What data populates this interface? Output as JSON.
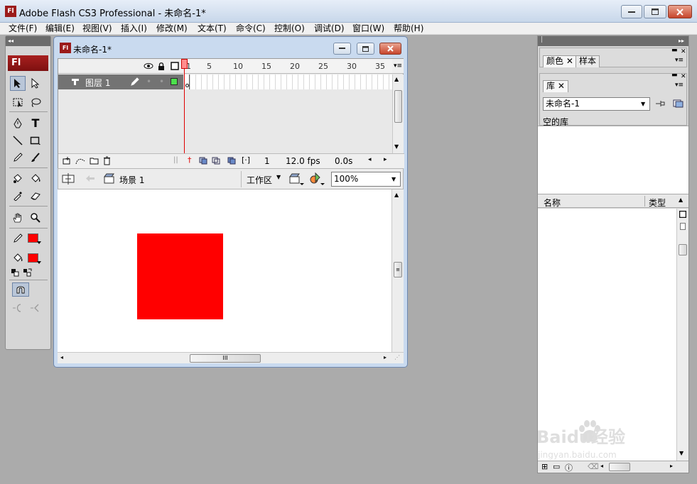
{
  "app": {
    "title": "Adobe Flash CS3 Professional - 未命名-1*",
    "logo": "Fl"
  },
  "menu": [
    "文件(F)",
    "编辑(E)",
    "视图(V)",
    "插入(I)",
    "修改(M)",
    "文本(T)",
    "命令(C)",
    "控制(O)",
    "调试(D)",
    "窗口(W)",
    "帮助(H)"
  ],
  "toolbox": {
    "badge": "Fl",
    "text_tool": "T",
    "stroke_color": "#ff0000",
    "fill_color": "#ff0000"
  },
  "document": {
    "title": "未命名-1*",
    "timeline": {
      "frame_numbers": [
        "1",
        "5",
        "10",
        "15",
        "20",
        "25",
        "30",
        "35"
      ],
      "layer_name": "图层 1",
      "current_frame": "1",
      "fps": "12.0 fps",
      "time": "0.0s"
    },
    "editbar": {
      "scene": "场景 1",
      "workspace": "工作区",
      "zoom": "100%"
    },
    "stage": {
      "shape_color": "#ff0000"
    },
    "scroll_grip": "III"
  },
  "panels": {
    "color_tabs": [
      "颜色",
      "样本"
    ],
    "library_tab": "库",
    "library_doc": "未命名-1",
    "library_empty": "空的库",
    "col_name": "名称",
    "col_type": "类型"
  },
  "watermark": {
    "brand": "Baidu经验",
    "url": "jingyan.baidu.com"
  }
}
